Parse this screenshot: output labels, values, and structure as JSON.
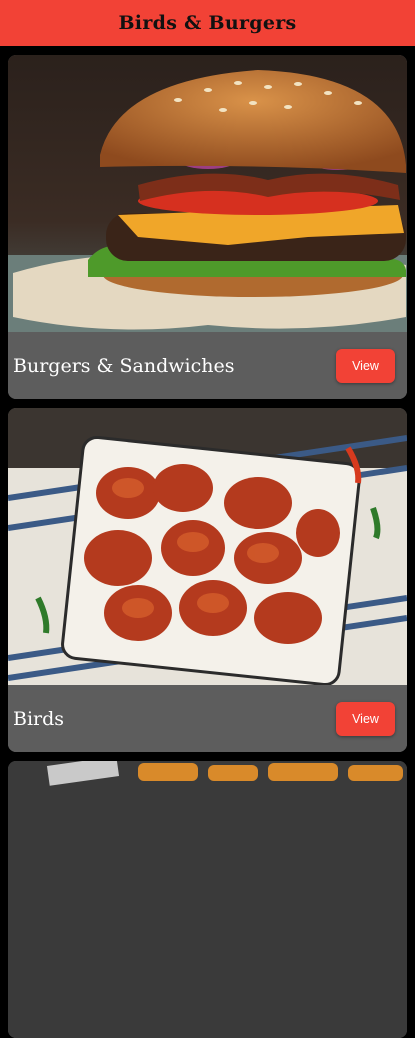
{
  "app_bar": {
    "title": "Birds & Burgers"
  },
  "categories": [
    {
      "title": "Burgers & Sandwiches",
      "view_label": "View",
      "image": "burger-photo"
    },
    {
      "title": "Birds",
      "view_label": "View",
      "image": "fried-chicken-photo"
    },
    {
      "title": "",
      "view_label": "",
      "image": "fries-photo"
    }
  ],
  "colors": {
    "accent": "#f24236",
    "card_footer": "#5d5d5d",
    "background": "#000000"
  }
}
